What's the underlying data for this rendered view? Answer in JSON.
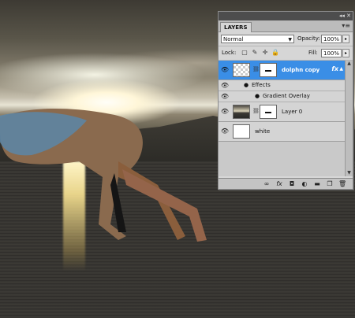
{
  "panel": {
    "tab_label": "LAYERS",
    "blend_mode": "Normal",
    "opacity_label": "Opacity:",
    "opacity_value": "100%",
    "lock_label": "Lock:",
    "fill_label": "Fill:",
    "fill_value": "100%"
  },
  "layers": [
    {
      "name": "dolphn copy",
      "selected": true,
      "has_fx": true,
      "fx_label": "fx"
    },
    {
      "effects_label": "Effects",
      "effect_item": "Gradient Overlay"
    },
    {
      "name": "Layer 0",
      "selected": false
    },
    {
      "name": "white",
      "selected": false
    }
  ],
  "icons": [
    "eye-icon",
    "chain-link-icon",
    "fx-icon",
    "mask-icon",
    "adjustment-icon",
    "folder-icon",
    "new-layer-icon",
    "trash-icon",
    "lock-icon",
    "move-icon",
    "brush-icon",
    "transparency-icon"
  ],
  "colors": {
    "selected_row": "#3a8ee6",
    "panel_bg": "#d6d6d6",
    "titlebar": "#4d4d4d"
  }
}
